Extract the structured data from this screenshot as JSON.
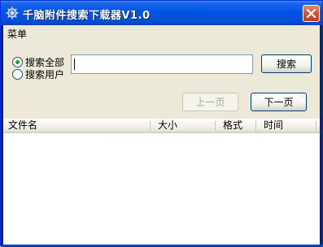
{
  "window": {
    "title": "千脑附件搜索下载器V1.0",
    "close_icon": "close-icon",
    "app_icon": "gear-icon",
    "title_bar_color": "#0055e5",
    "client_bg": "#ece9d8"
  },
  "menubar": {
    "items": [
      {
        "label": "菜单"
      }
    ]
  },
  "search": {
    "scope_options": [
      {
        "label": "搜索全部",
        "selected": true
      },
      {
        "label": "搜索用户",
        "selected": false
      }
    ],
    "input_value": "",
    "search_button": "搜索"
  },
  "pagination": {
    "prev_label": "上一页",
    "prev_enabled": false,
    "next_label": "下一页",
    "next_enabled": true
  },
  "results": {
    "columns": [
      "文件名",
      "大小",
      "格式",
      "时间"
    ],
    "rows": []
  }
}
